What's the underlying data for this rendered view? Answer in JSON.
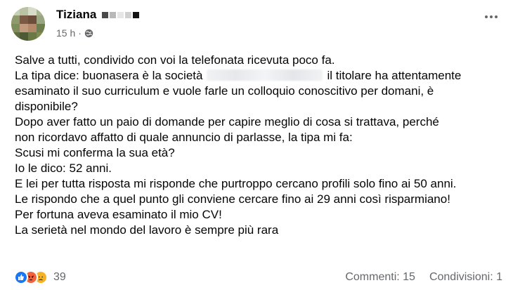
{
  "post": {
    "author_name": "Tiziana",
    "timestamp": "15 h",
    "separator": "·",
    "visibility_icon": "globe-icon",
    "lines": [
      {
        "text": "Salve a tutti, condivido con voi la telefonata ricevuta poco fa."
      },
      {
        "before": "La tipa dice: buonasera è la società",
        "after": "il titolare ha attentamente"
      },
      {
        "text": "esaminato il suo curriculum e vuole farle un colloquio conoscitivo per domani, è"
      },
      {
        "text": "disponibile?"
      },
      {
        "text": "Dopo aver fatto un paio di domande per capire meglio di cosa si trattava, perché"
      },
      {
        "text": "non ricordavo affatto di quale annuncio di parlasse, la tipa mi fa:"
      },
      {
        "text": "Scusi mi conferma la sua età?"
      },
      {
        "text": "Io le dico: 52 anni."
      },
      {
        "text": "E lei per tutta risposta mi risponde che purtroppo cercano profili solo fino ai 50 anni."
      },
      {
        "text": "Le rispondo che a quel punto gli conviene cercare fino ai 29 anni così risparmiano!"
      },
      {
        "text": "Per fortuna aveva esaminato il mio CV!"
      },
      {
        "text": "La serietà nel mondo del lavoro è sempre più rara"
      }
    ]
  },
  "footer": {
    "reactions": [
      "like-icon",
      "angry-icon",
      "sad-icon"
    ],
    "reaction_count": "39",
    "comments": "Commenti: 15",
    "shares": "Condivisioni: 1"
  },
  "colors": {
    "secondary_text": "#65676b",
    "like": "#1877f2",
    "angry": "#f0633c",
    "sad": "#f7b125"
  }
}
